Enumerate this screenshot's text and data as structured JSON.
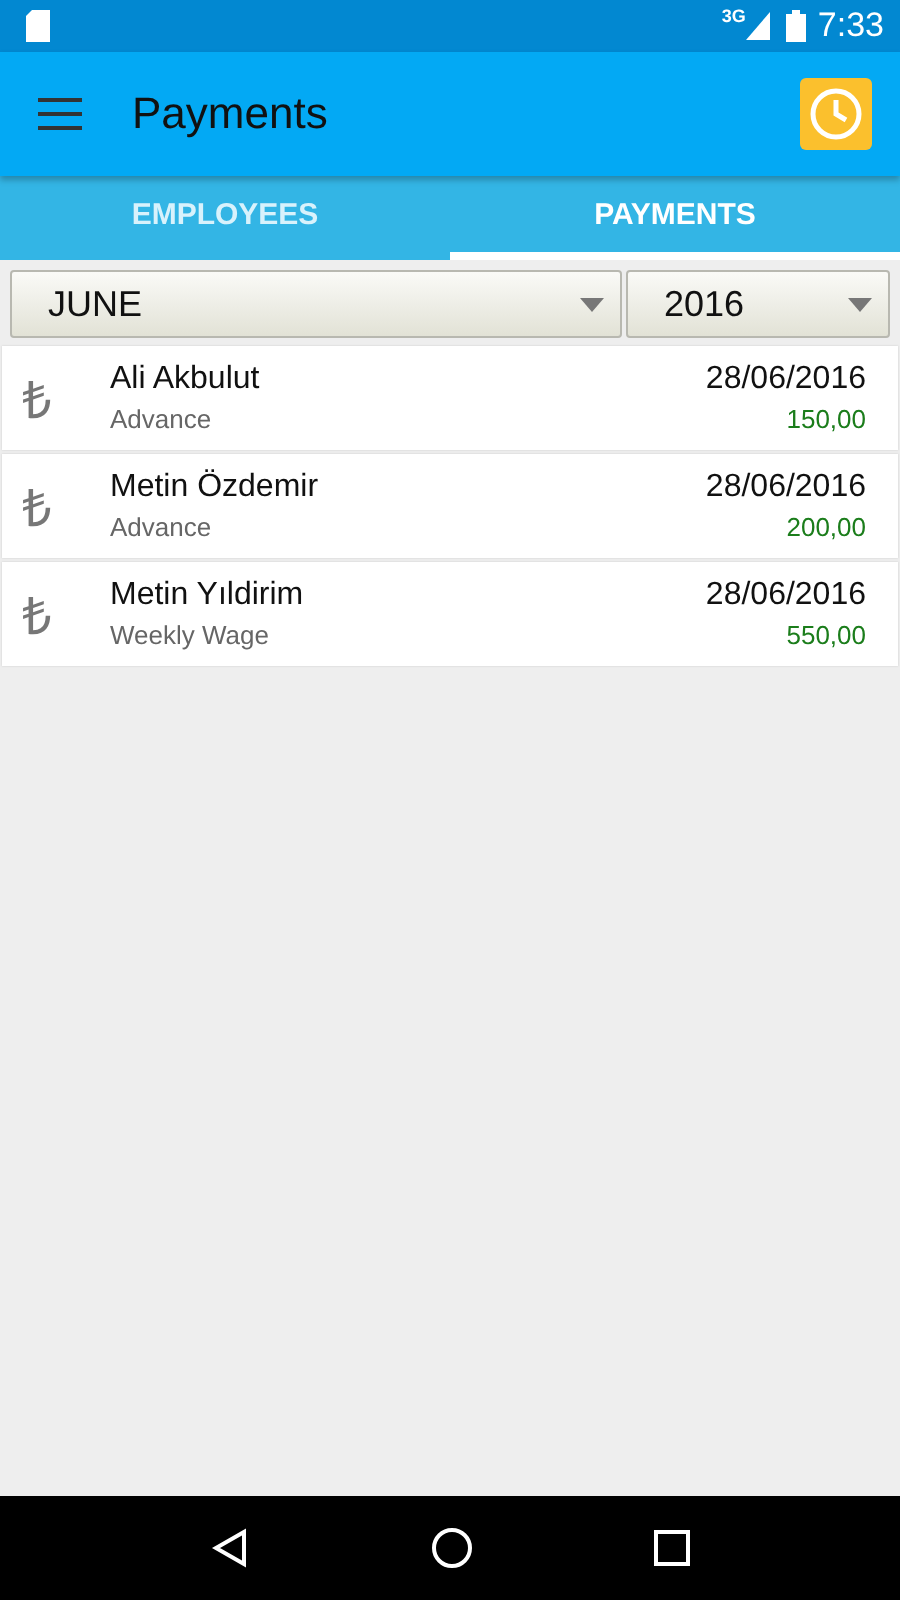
{
  "status_bar": {
    "network": "3G",
    "time": "7:33"
  },
  "app_bar": {
    "title": "Payments"
  },
  "tabs": [
    {
      "label": "EMPLOYEES",
      "selected": false
    },
    {
      "label": "PAYMENTS",
      "selected": true
    }
  ],
  "filters": [
    {
      "value": "JUNE",
      "kind": "month"
    },
    {
      "value": "2016",
      "kind": "year"
    }
  ],
  "payments": [
    {
      "icon": "₺",
      "name": "Ali Akbulut",
      "type": "Advance",
      "date": "28/06/2016",
      "amount": "150,00"
    },
    {
      "icon": "₺",
      "name": "Metin Özdemir",
      "type": "Advance",
      "date": "28/06/2016",
      "amount": "200,00"
    },
    {
      "icon": "₺",
      "name": "Metin Yıldirim",
      "type": "Weekly Wage",
      "date": "28/06/2016",
      "amount": "550,00"
    }
  ]
}
